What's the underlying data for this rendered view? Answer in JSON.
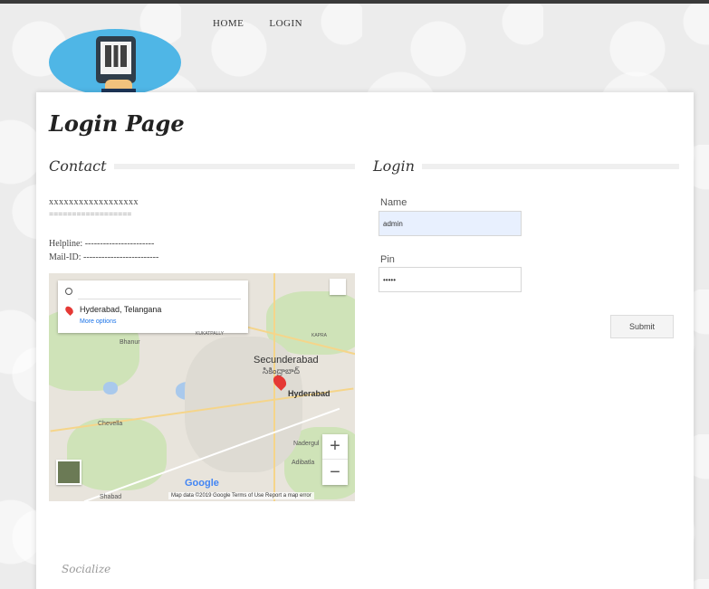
{
  "nav": {
    "home": "HOME",
    "login": "LOGIN"
  },
  "page": {
    "title": "Login Page"
  },
  "contact": {
    "heading": "Contact",
    "line1": "xxxxxxxxxxxxxxxxxx",
    "line2": "==================",
    "helpline": "Helpline: -----------------------",
    "mailid": "Mail-ID: -------------------------"
  },
  "map": {
    "destination": "Hyderabad, Telangana",
    "more_options": "More options",
    "secunderabad": "Secunderabad",
    "secunderabad_te": "సికింద్రాబాద్",
    "hyderabad": "Hyderabad",
    "bhanur": "Bhanur",
    "chevella": "Chevella",
    "kukatpally": "KUKATPALLY",
    "kapra": "KAPRA",
    "nadergul": "Nadergul",
    "adibatla": "Adibatla",
    "shabad": "Shabad",
    "zoom_in": "+",
    "zoom_out": "−",
    "google": "Google",
    "footer": "Map data ©2019 Google   Terms of Use   Report a map error"
  },
  "login": {
    "heading": "Login",
    "name_label": "Name",
    "name_value": "admin",
    "pin_label": "Pin",
    "pin_value": "•••••",
    "submit": "Submit"
  },
  "footer": {
    "socialize": "Socialize"
  },
  "colors": {
    "accent": "#4fb6e6",
    "card": "#ffffff",
    "name_field_bg": "#e8f0fe"
  }
}
